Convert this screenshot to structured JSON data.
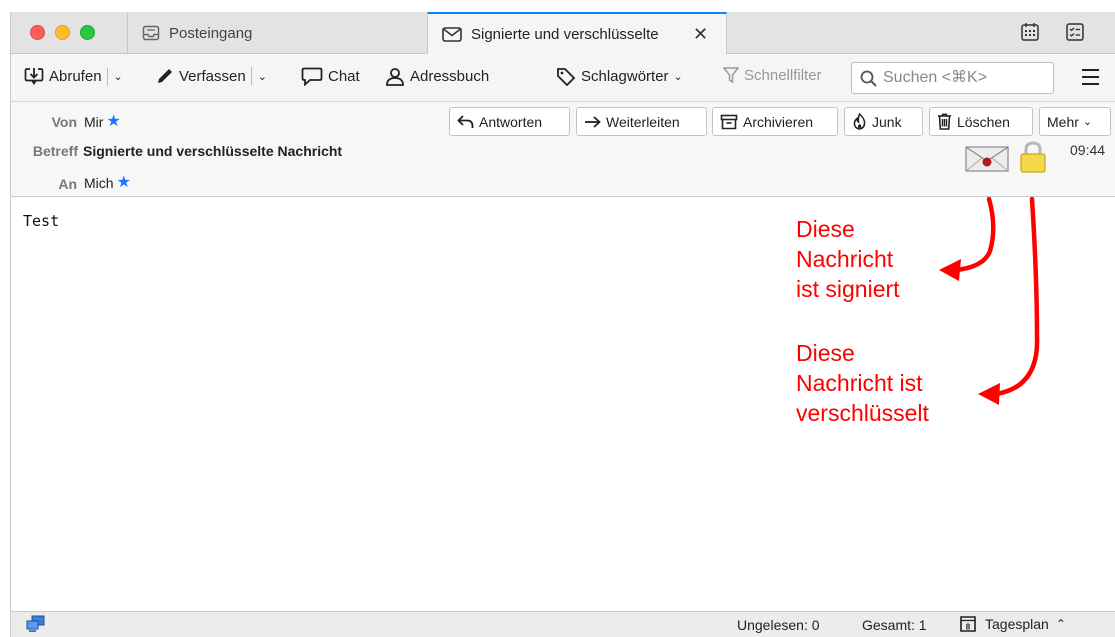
{
  "tabs": {
    "inbox_label": "Posteingang",
    "message_label": "Signierte und verschlüsselte",
    "close_glyph": "✕"
  },
  "toolbar": {
    "get_mail": "Abrufen",
    "write": "Verfassen",
    "chat": "Chat",
    "address_book": "Adressbuch",
    "tags": "Schlagwörter",
    "quick_filter": "Schnellfilter",
    "search_placeholder": "Suchen <⌘K>"
  },
  "header": {
    "from_label": "Von",
    "from_value": "Mir",
    "subject_label": "Betreff",
    "subject_value": "Signierte und verschlüsselte Nachricht",
    "to_label": "An",
    "to_value": "Mich",
    "time": "09:44",
    "actions": {
      "reply": "Antworten",
      "forward": "Weiterleiten",
      "archive": "Archivieren",
      "junk": "Junk",
      "delete": "Löschen",
      "more": "Mehr"
    }
  },
  "message": {
    "body": "Test"
  },
  "annotations": {
    "signed": [
      "Diese",
      "Nachricht",
      "ist signiert"
    ],
    "encrypted": [
      "Diese",
      "Nachricht ist",
      "verschlüsselt"
    ]
  },
  "statusbar": {
    "unread": "Ungelesen: 0",
    "total": "Gesamt: 1",
    "agenda": "Tagesplan"
  },
  "colors": {
    "accent": "#0a84ff",
    "annotation": "#ff0000",
    "star": "#1a75ff"
  }
}
